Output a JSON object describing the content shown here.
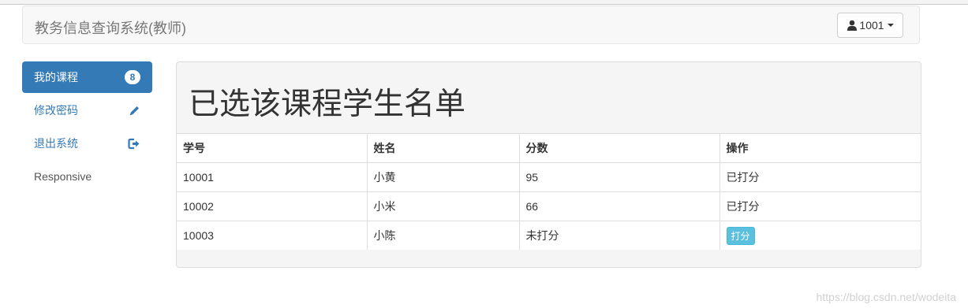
{
  "navbar": {
    "brand": "教务信息查询系统(教师)",
    "user_label": "1001"
  },
  "sidebar": {
    "items": [
      {
        "label": "我的课程",
        "badge": "8"
      },
      {
        "label": "修改密码"
      },
      {
        "label": "退出系统"
      },
      {
        "label": "Responsive"
      }
    ]
  },
  "main": {
    "title": "已选该课程学生名单",
    "table": {
      "headers": [
        "学号",
        "姓名",
        "分数",
        "操作"
      ],
      "rows": [
        [
          "10001",
          "小黄",
          "95",
          "已打分"
        ],
        [
          "10002",
          "小米",
          "66",
          "已打分"
        ],
        [
          "10003",
          "小陈",
          "未打分",
          "打分"
        ]
      ]
    }
  },
  "watermark": "https://blog.csdn.net/wodeita",
  "colors": {
    "primary": "#337ab7",
    "info": "#5bc0de"
  }
}
